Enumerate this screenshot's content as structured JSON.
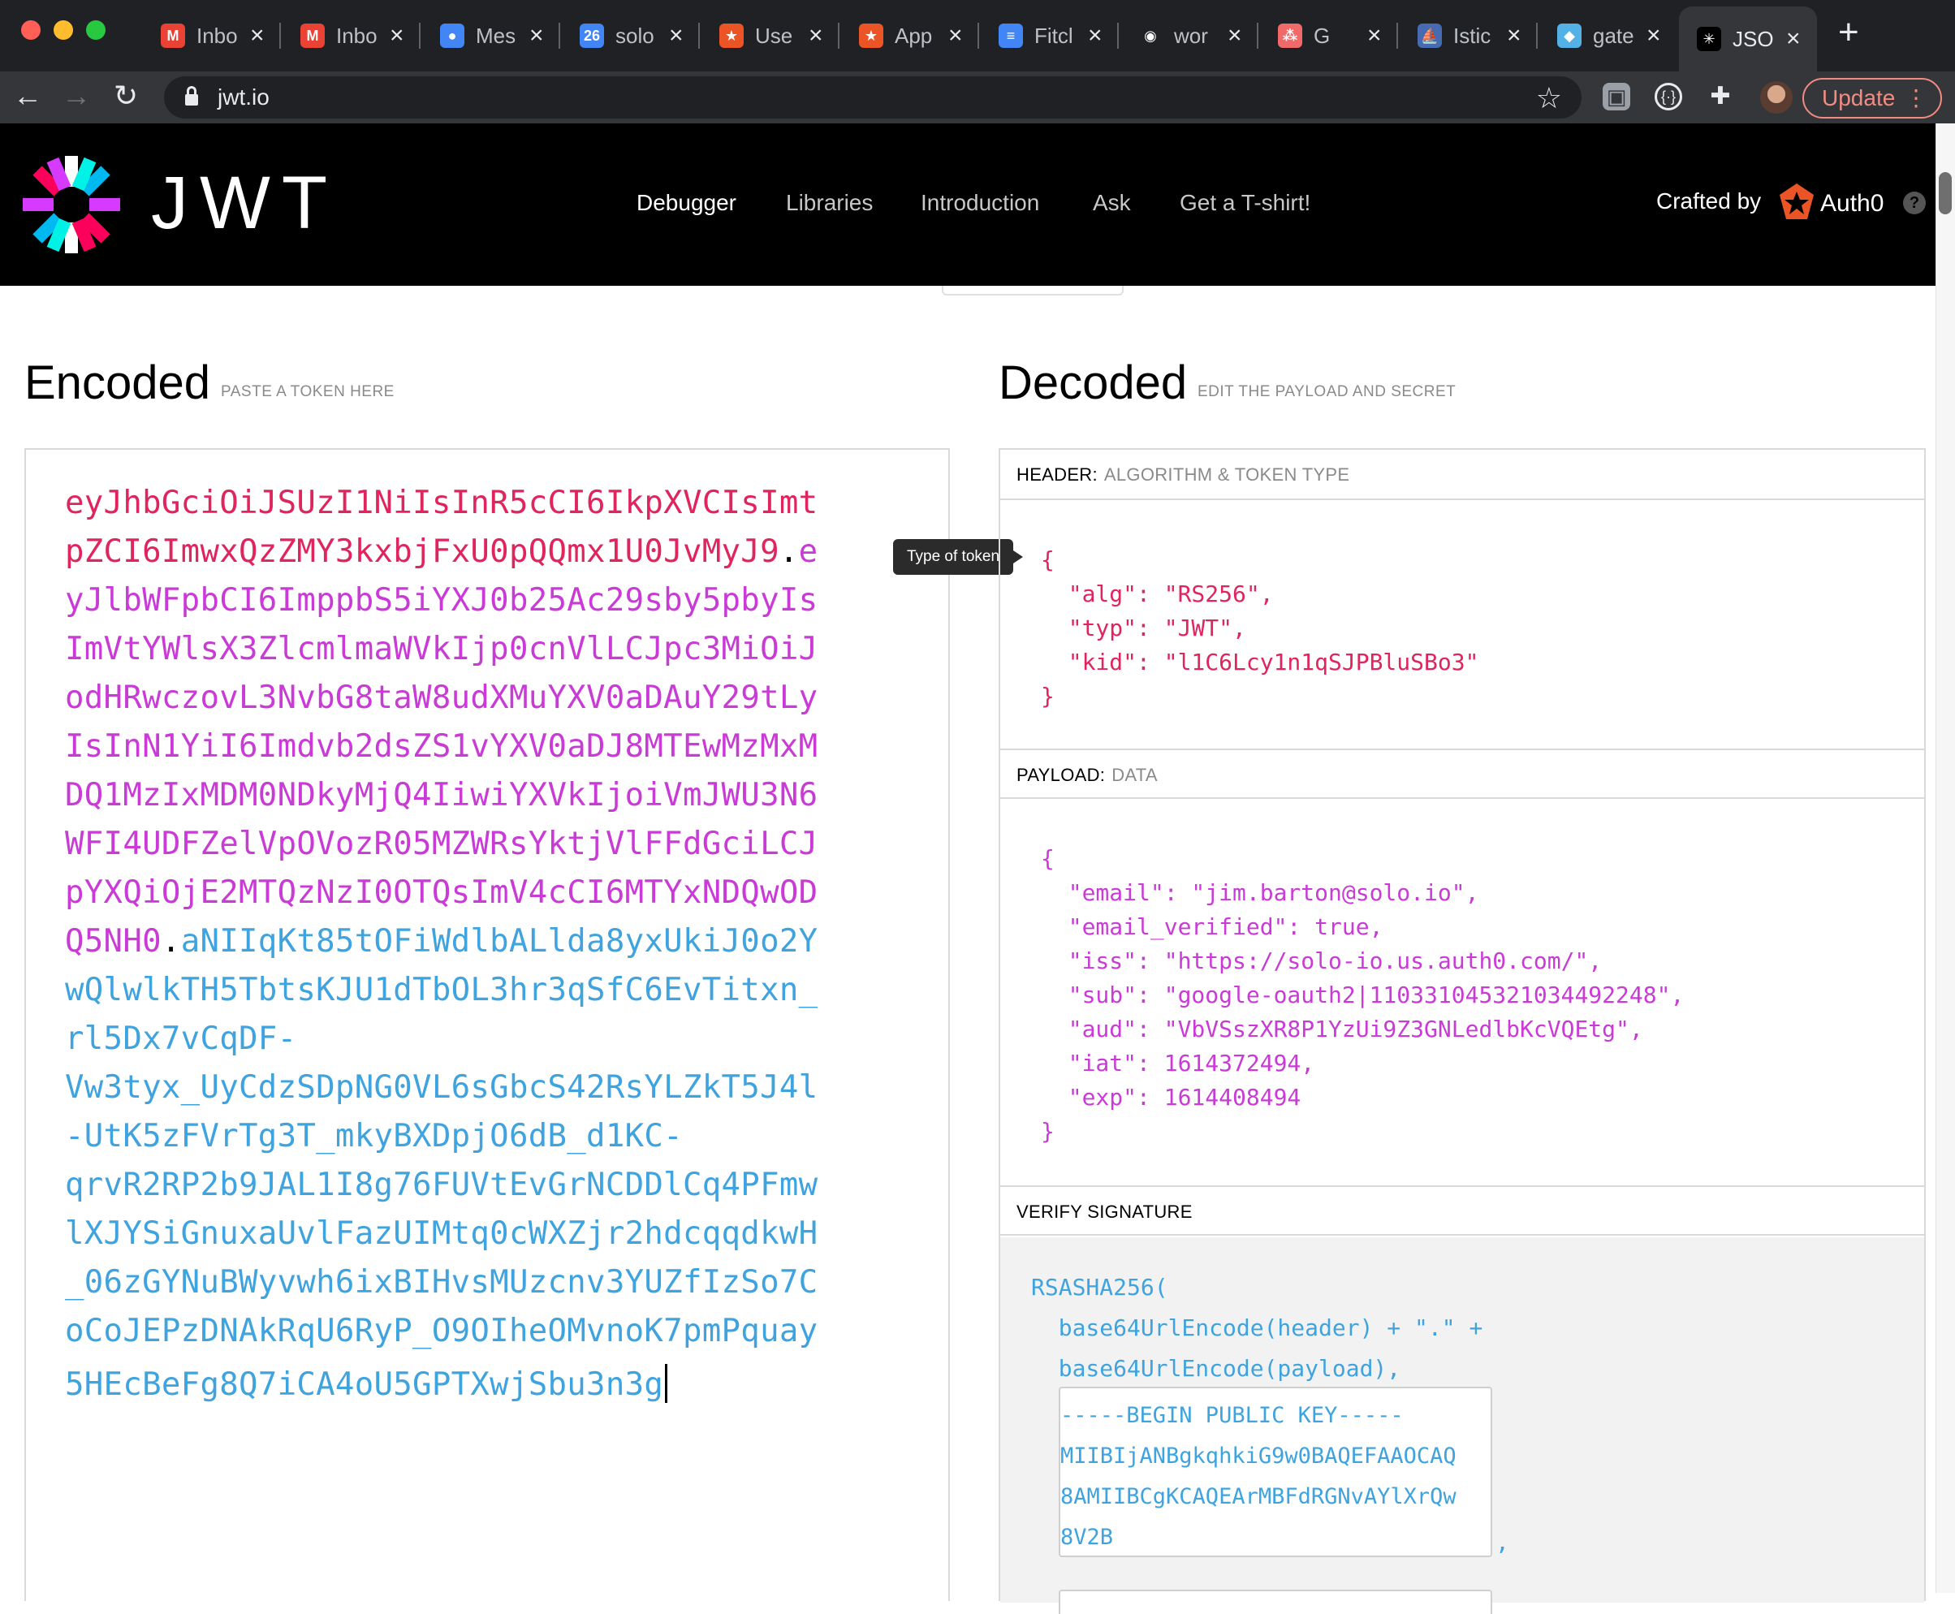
{
  "browser": {
    "tabs": [
      {
        "label": "Inbo",
        "icon": "gmail-icon",
        "glyph": "M",
        "color": "#ea4335"
      },
      {
        "label": "Inbo",
        "icon": "gmail-icon",
        "glyph": "M",
        "color": "#ea4335"
      },
      {
        "label": "Mes",
        "icon": "messages-icon",
        "glyph": "●",
        "color": "#4285f4"
      },
      {
        "label": "solo",
        "icon": "calendar-icon",
        "glyph": "26",
        "color": "#4285f4"
      },
      {
        "label": "Use",
        "icon": "auth0-icon",
        "glyph": "★",
        "color": "#eb5424"
      },
      {
        "label": "App",
        "icon": "auth0-icon",
        "glyph": "★",
        "color": "#eb5424"
      },
      {
        "label": "Fitcl",
        "icon": "docs-icon",
        "glyph": "≡",
        "color": "#4285f4"
      },
      {
        "label": "wor",
        "icon": "github-icon",
        "glyph": "◉",
        "color": "#202124"
      },
      {
        "label": "G",
        "icon": "asana-icon",
        "glyph": "⁂",
        "color": "#f06a6a"
      },
      {
        "label": "Istic",
        "icon": "istio-icon",
        "glyph": "⛵",
        "color": "#466bb0"
      },
      {
        "label": "gate",
        "icon": "gloo-icon",
        "glyph": "◆",
        "color": "#54b1e5"
      },
      {
        "label": "JSO",
        "icon": "jwt-icon",
        "glyph": "✳",
        "color": "#000000",
        "active": true
      }
    ],
    "url": "jwt.io",
    "update_label": "Update"
  },
  "site": {
    "brand": "JWT",
    "nav": [
      "Debugger",
      "Libraries",
      "Introduction",
      "Ask",
      "Get a T-shirt!"
    ],
    "crafted_by": "Crafted by",
    "partner": "Auth0",
    "help": "?"
  },
  "encoded": {
    "title": "Encoded",
    "subtitle": "PASTE A TOKEN HERE",
    "lines": [
      [
        {
          "t": "eyJhbGciOiJSUzI1NiIsInR5cCI6IkpXVCIsImt",
          "c": "head"
        }
      ],
      [
        {
          "t": "pZCI6ImwxQzZMY3kxbjFxU0pQQmx1U0JvMyJ9",
          "c": "head"
        },
        {
          "t": ".",
          "c": "dot"
        },
        {
          "t": "e",
          "c": "pay"
        }
      ],
      [
        {
          "t": "yJlbWFpbCI6ImppbS5iYXJ0b25Ac29sby5pbyIs",
          "c": "pay"
        }
      ],
      [
        {
          "t": "ImVtYWlsX3ZlcmlmaWVkIjp0cnVlLCJpc3MiOiJ",
          "c": "pay"
        }
      ],
      [
        {
          "t": "odHRwczovL3NvbG8taW8udXMuYXV0aDAuY29tLy",
          "c": "pay"
        }
      ],
      [
        {
          "t": "IsInN1YiI6Imdvb2dsZS1vYXV0aDJ8MTEwMzMxM",
          "c": "pay"
        }
      ],
      [
        {
          "t": "DQ1MzIxMDM0NDkyMjQ4IiwiYXVkIjoiVmJWU3N6",
          "c": "pay"
        }
      ],
      [
        {
          "t": "WFI4UDFZelVpOVozR05MZWRsYktjVlFFdGciLCJ",
          "c": "pay"
        }
      ],
      [
        {
          "t": "pYXQiOjE2MTQzNzI0OTQsImV4cCI6MTYxNDQwOD",
          "c": "pay"
        }
      ],
      [
        {
          "t": "Q5NH0",
          "c": "pay"
        },
        {
          "t": ".",
          "c": "dot"
        },
        {
          "t": "aNIIqKt85tOFiWdlbALlda8yxUkiJ0o2Y",
          "c": "sig"
        }
      ],
      [
        {
          "t": "wQlwlkTH5TbtsKJU1dTbOL3hr3qSfC6EvTitxn_",
          "c": "sig"
        }
      ],
      [
        {
          "t": "rl5Dx7vCqDF-",
          "c": "sig"
        }
      ],
      [
        {
          "t": "Vw3tyx_UyCdzSDpNG0VL6sGbcS42RsYLZkT5J4l",
          "c": "sig"
        }
      ],
      [
        {
          "t": "-UtK5zFVrTg3T_mkyBXDpjO6dB_d1KC-",
          "c": "sig"
        }
      ],
      [
        {
          "t": "qrvR2RP2b9JAL1I8g76FUVtEvGrNCDDlCq4PFmw",
          "c": "sig"
        }
      ],
      [
        {
          "t": "lXJYSiGnuxaUvlFazUIMtq0cWXZjr2hdcqqdkwH",
          "c": "sig"
        }
      ],
      [
        {
          "t": "_06zGYNuBWyvwh6ixBIHvsMUzcnv3YUZfIzSo7C",
          "c": "sig"
        }
      ],
      [
        {
          "t": "oCoJEPzDNAkRqU6RyP_O9OIheOMvnoK7pmPquay",
          "c": "sig"
        }
      ],
      [
        {
          "t": "5HEcBeFg8Q7iCA4oU5GPTXwjSbu3n3g",
          "c": "sig"
        }
      ]
    ]
  },
  "tooltip": "Type of token",
  "decoded": {
    "title": "Decoded",
    "subtitle": "EDIT THE PAYLOAD AND SECRET",
    "header_label": "HEADER:",
    "header_sub": "ALGORITHM & TOKEN TYPE",
    "header_json": [
      "{",
      "  \"alg\": \"RS256\",",
      "  \"typ\": \"JWT\",",
      "  \"kid\": \"l1C6Lcy1n1qSJPBluSBo3\"",
      "}"
    ],
    "payload_label": "PAYLOAD:",
    "payload_sub": "DATA",
    "payload_json": [
      "{",
      "  \"email\": \"jim.barton@solo.io\",",
      "  \"email_verified\": true,",
      "  \"iss\": \"https://solo-io.us.auth0.com/\",",
      "  \"sub\": \"google-oauth2|110331045321034492248\",",
      "  \"aud\": \"VbVSszXR8P1YzUi9Z3GNLedlbKcVQEtg\",",
      "  \"iat\": 1614372494,",
      "  \"exp\": 1614408494",
      "}"
    ],
    "verify_label": "VERIFY SIGNATURE",
    "verify_lines": [
      "RSASHA256(",
      "  base64UrlEncode(header) + \".\" +",
      "  base64UrlEncode(payload),"
    ],
    "public_key_lines": [
      "-----BEGIN PUBLIC KEY-----",
      "MIIBIjANBgkqhkiG9w0BAQEFAAOCAQ",
      "8AMIIBCgKCAQEArMBFdRGNvAYlXrQw",
      "8V2B"
    ],
    "comma": ","
  }
}
